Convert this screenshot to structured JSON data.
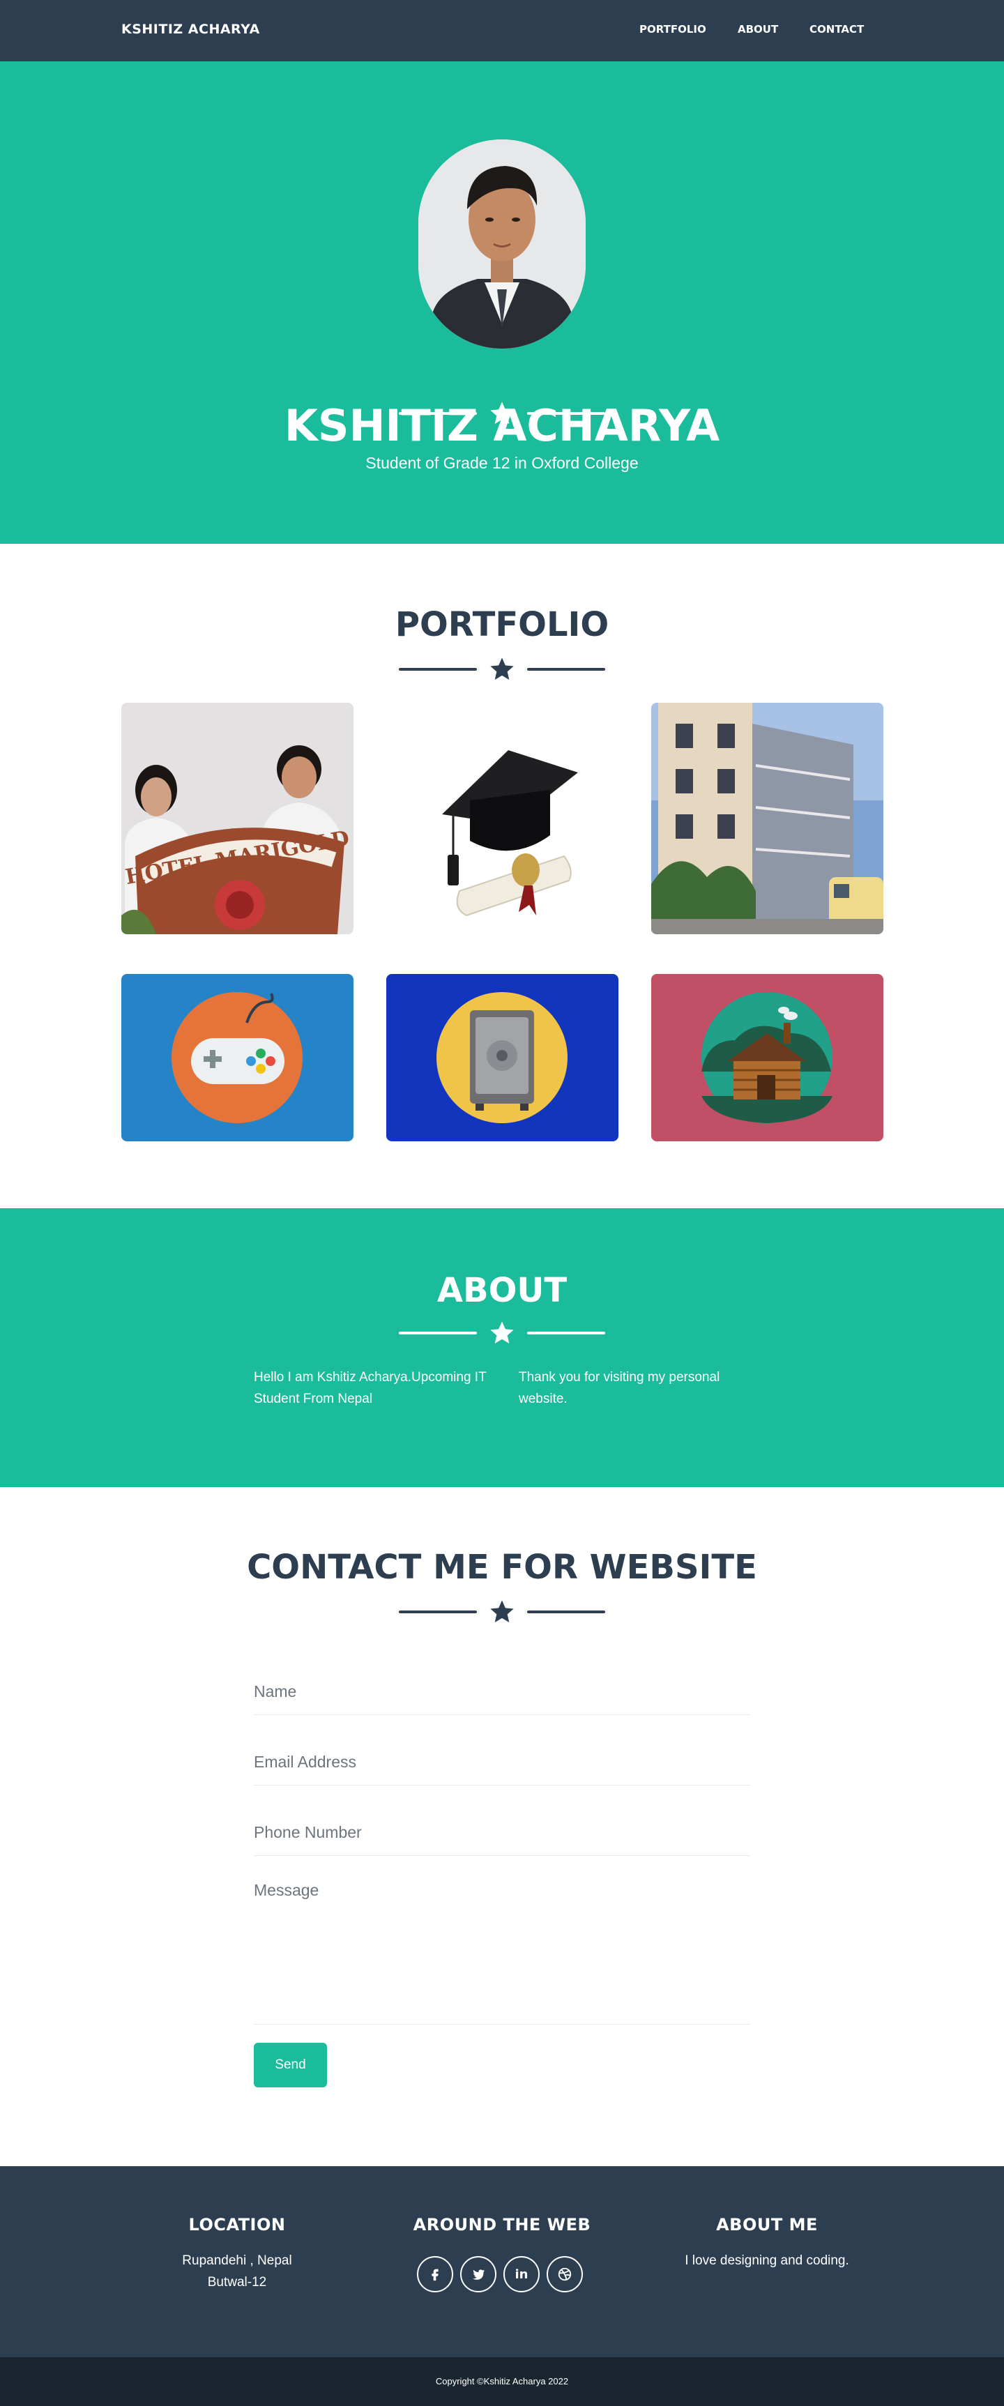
{
  "navbar": {
    "brand": "KSHITIZ ACHARYA",
    "links": [
      "PORTFOLIO",
      "ABOUT",
      "CONTACT"
    ]
  },
  "masthead": {
    "title": "KSHITIZ ACHARYA",
    "subtitle": "Student of Grade 12 in Oxford College"
  },
  "portfolio": {
    "title": "PORTFOLIO",
    "items": [
      "school-speech-photo",
      "graduation-cap-diploma",
      "college-building-photo",
      "game-controller",
      "safe",
      "log-cabin"
    ]
  },
  "about": {
    "title": "ABOUT",
    "left_text": "Hello I am Kshitiz Acharya.Upcoming IT Student From Nepal",
    "right_text": "Thank you for visiting my personal website."
  },
  "contact": {
    "title": "CONTACT ME FOR WEBSITE",
    "name_placeholder": "Name",
    "email_placeholder": "Email Address",
    "phone_placeholder": "Phone Number",
    "message_placeholder": "Message",
    "send_label": "Send"
  },
  "footer": {
    "location_heading": "LOCATION",
    "location_line1": "Rupandehi , Nepal",
    "location_line2": "Butwal-12",
    "web_heading": "AROUND THE WEB",
    "social_icons": [
      "facebook-icon",
      "twitter-icon",
      "linkedin-icon",
      "dribbble-icon"
    ],
    "about_heading": "ABOUT ME",
    "about_text": "I love designing and coding.",
    "copyright": "Copyright ©Kshitiz Acharya 2022"
  },
  "colors": {
    "primary": "#1abc9c",
    "dark": "#2c3e50",
    "darker": "#1a252f"
  }
}
